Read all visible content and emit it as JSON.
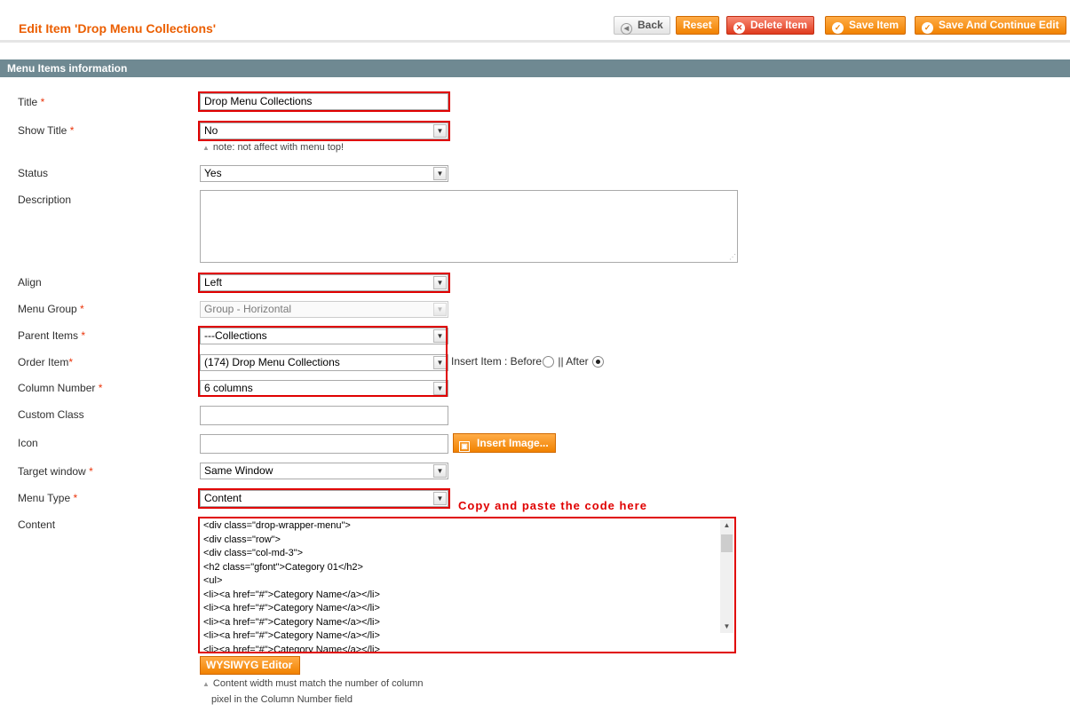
{
  "header": {
    "title": "Edit Item 'Drop Menu Collections'",
    "buttons": {
      "back": "Back",
      "reset": "Reset",
      "delete": "Delete Item",
      "save": "Save Item",
      "save_continue": "Save And Continue Edit"
    }
  },
  "section": {
    "title": "Menu Items information"
  },
  "required_mark": "*",
  "fields": {
    "title": {
      "label": "Title",
      "value": "Drop Menu Collections"
    },
    "show_title": {
      "label": "Show Title",
      "value": "No",
      "note": "note: not affect with menu top!"
    },
    "status": {
      "label": "Status",
      "value": "Yes"
    },
    "description": {
      "label": "Description",
      "value": ""
    },
    "align": {
      "label": "Align",
      "value": "Left"
    },
    "menu_group": {
      "label": "Menu Group",
      "value": "Group - Horizontal"
    },
    "parent_items": {
      "label": "Parent Items",
      "value": "---Collections"
    },
    "order_item": {
      "label": "Order Item",
      "value": "(174) Drop Menu Collections",
      "insert_label": "Insert Item : Before",
      "after_label": "|| After",
      "selected_position": "After"
    },
    "column_number": {
      "label": "Column Number",
      "value": "6 columns"
    },
    "custom_class": {
      "label": "Custom Class",
      "value": ""
    },
    "icon": {
      "label": "Icon",
      "value": "",
      "button": "Insert Image..."
    },
    "target_window": {
      "label": "Target window",
      "value": "Same Window"
    },
    "menu_type": {
      "label": "Menu Type",
      "value": "Content"
    },
    "content": {
      "label": "Content",
      "lines": [
        "<div class=\"drop-wrapper-menu\">",
        "<div class=\"row\">",
        "<div class=\"col-md-3\">",
        "<h2 class=\"gfont\">Category 01</h2>",
        "<ul>",
        "<li><a href=\"#\">Category Name</a></li>",
        "<li><a href=\"#\">Category Name</a></li>",
        "<li><a href=\"#\">Category Name</a></li>",
        "<li><a href=\"#\">Category Name</a></li>",
        "<li><a href=\"#\">Category Name</a></li>"
      ],
      "editor_button": "WYSIWYG Editor",
      "note_line1": "Content width must match the number of column",
      "note_line2": "pixel in the Column Number field"
    }
  },
  "annotation": "Copy and paste the code here",
  "colors": {
    "accent": "#eb5e00",
    "highlight": "#e00000",
    "section_bar": "#6f8992"
  }
}
